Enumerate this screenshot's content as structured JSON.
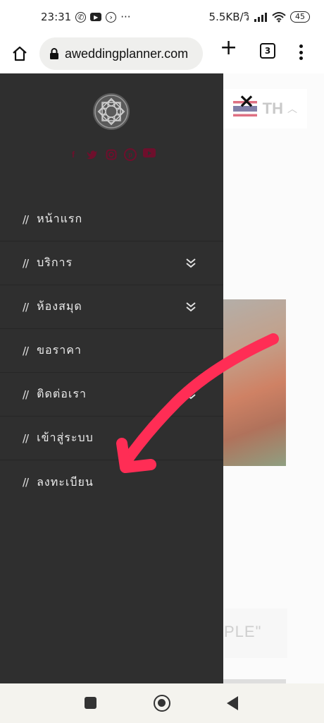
{
  "status_bar": {
    "time": "23:31",
    "more": "···",
    "net_speed": "5.5KB/วิ",
    "battery": "45"
  },
  "browser": {
    "url": "aweddingplanner.com",
    "tab_count": "3",
    "new_tab": "+"
  },
  "page": {
    "language": "TH",
    "quote_fragment": "PLE\""
  },
  "drawer": {
    "close_label": "×",
    "social": [
      "f",
      "twitter",
      "instagram",
      "pinterest",
      "youtube"
    ],
    "menu": [
      {
        "prefix": "//",
        "label": "หน้าแรก",
        "has_submenu": false
      },
      {
        "prefix": "//",
        "label": "บริการ",
        "has_submenu": true
      },
      {
        "prefix": "//",
        "label": "ห้องสมุด",
        "has_submenu": true
      },
      {
        "prefix": "//",
        "label": "ขอราคา",
        "has_submenu": false
      },
      {
        "prefix": "//",
        "label": "ติดต่อเรา",
        "has_submenu": true
      },
      {
        "prefix": "//",
        "label": "เข้าสู่ระบบ",
        "has_submenu": false
      },
      {
        "prefix": "//",
        "label": "ลงทะเบียน",
        "has_submenu": false
      }
    ]
  },
  "colors": {
    "drawer_bg": "#2f2f2f",
    "social_accent": "#6e0f2c",
    "annotation_arrow": "#ff2d55"
  }
}
